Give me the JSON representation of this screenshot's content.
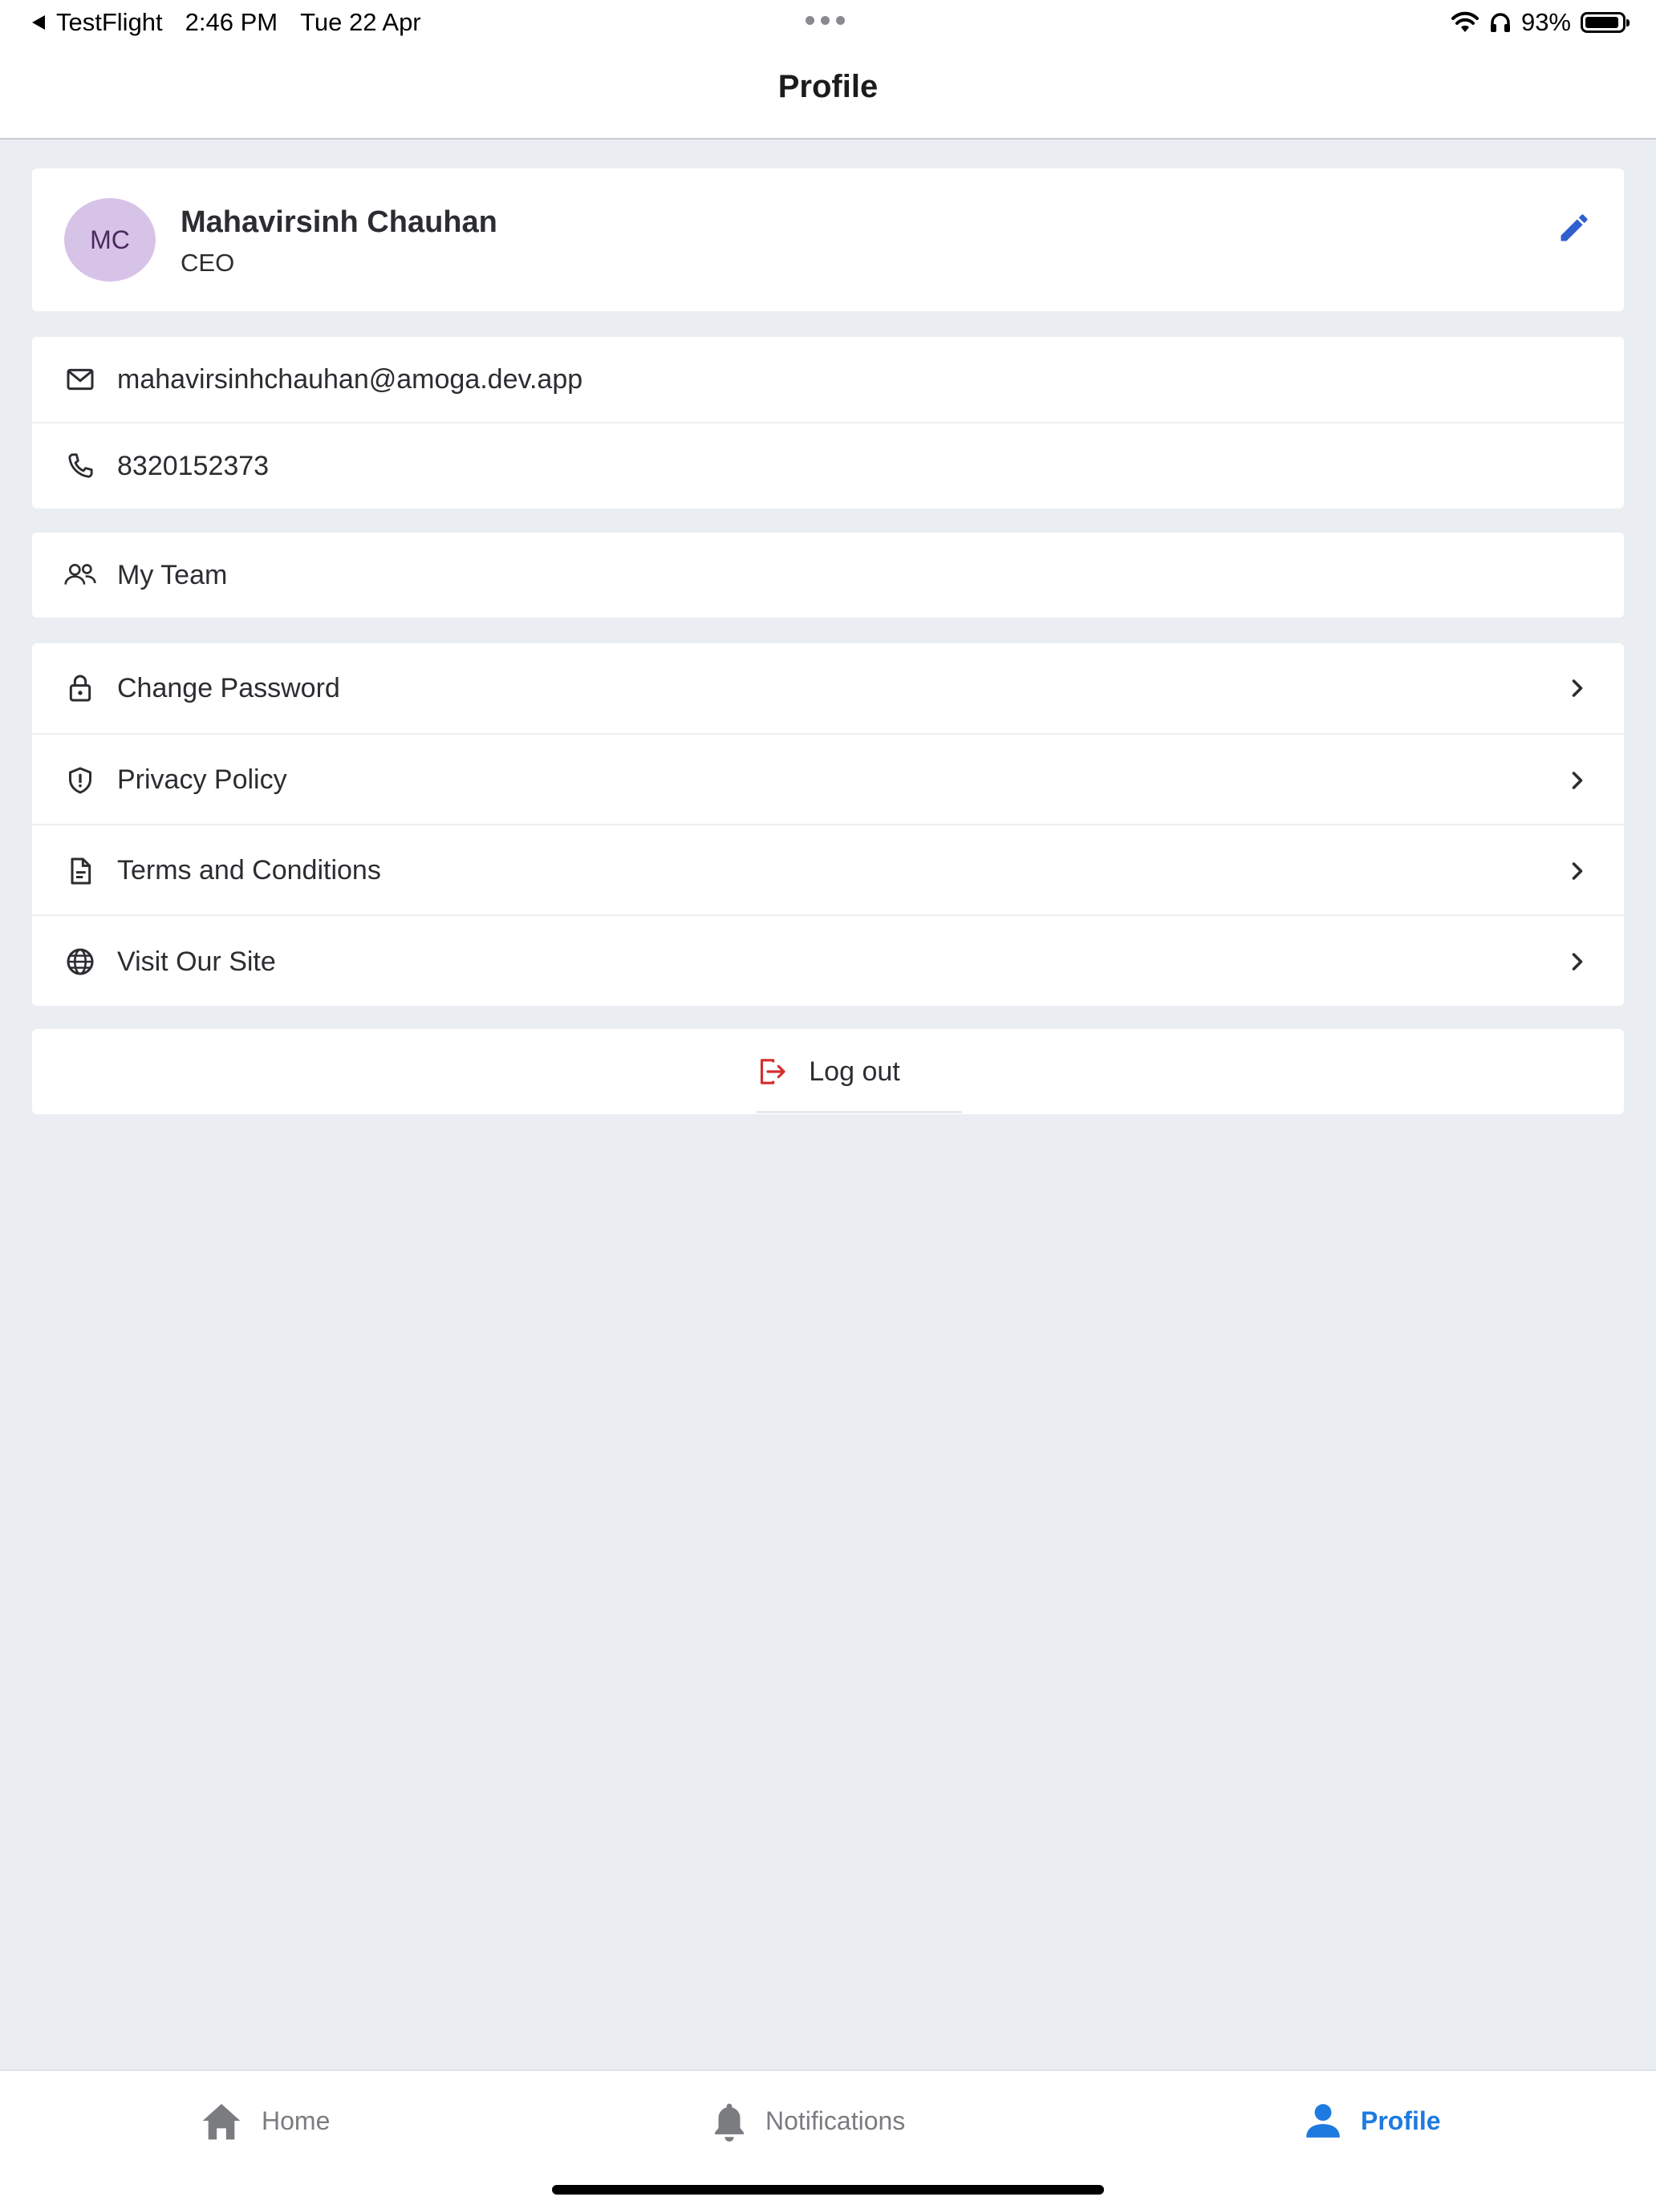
{
  "status_bar": {
    "back_app": "TestFlight",
    "time": "2:46 PM",
    "date": "Tue 22 Apr",
    "battery": "93%",
    "battery_level": 0.93
  },
  "header": {
    "title": "Profile"
  },
  "profile": {
    "initials": "MC",
    "name": "Mahavirsinh Chauhan",
    "role": "CEO"
  },
  "contact": {
    "email": "mahavirsinhchauhan@amoga.dev.app",
    "phone": "8320152373"
  },
  "team": {
    "label": "My Team"
  },
  "settings": {
    "items": [
      {
        "label": "Change Password",
        "icon": "lock-icon"
      },
      {
        "label": "Privacy Policy",
        "icon": "shield-icon"
      },
      {
        "label": "Terms and Conditions",
        "icon": "document-icon"
      },
      {
        "label": "Visit Our Site",
        "icon": "globe-icon"
      }
    ]
  },
  "logout": {
    "label": "Log out"
  },
  "tabs": [
    {
      "label": "Home",
      "icon": "home-icon",
      "active": false
    },
    {
      "label": "Notifications",
      "icon": "bell-icon",
      "active": false
    },
    {
      "label": "Profile",
      "icon": "person-icon",
      "active": true
    }
  ],
  "colors": {
    "accent": "#1f7ae0",
    "edit": "#2f5fcf",
    "logout_icon": "#d32f2f",
    "avatar_bg": "#d8c3e8",
    "background": "#eaedf2"
  }
}
